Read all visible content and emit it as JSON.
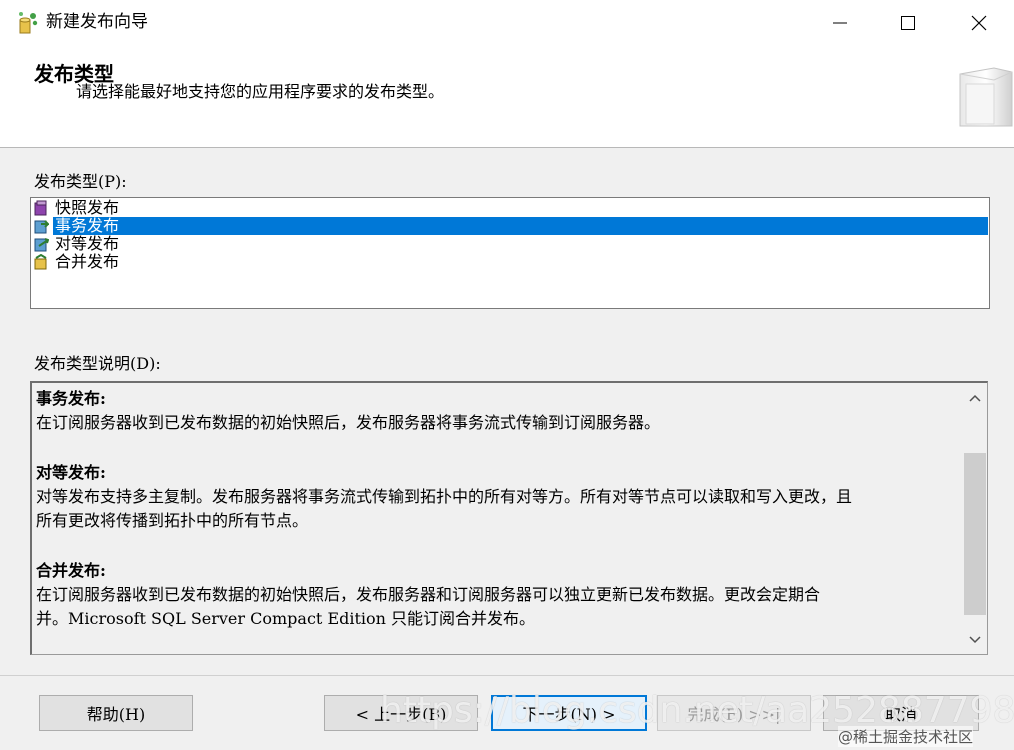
{
  "window": {
    "title": "新建发布向导",
    "icon": "publication-wizard-icon"
  },
  "header": {
    "title": "发布类型",
    "subtitle": "请选择能最好地支持您的应用程序要求的发布类型。"
  },
  "publication_type": {
    "label": "发布类型(P):",
    "items": [
      {
        "label": "快照发布",
        "icon": "snapshot-publication-icon",
        "selected": false
      },
      {
        "label": "事务发布",
        "icon": "transactional-publication-icon",
        "selected": true
      },
      {
        "label": "对等发布",
        "icon": "peer-to-peer-publication-icon",
        "selected": false
      },
      {
        "label": "合并发布",
        "icon": "merge-publication-icon",
        "selected": false
      }
    ]
  },
  "description": {
    "label": "发布类型说明(D):",
    "sections": [
      {
        "title": "事务发布:",
        "lines": [
          "在订阅服务器收到已发布数据的初始快照后，发布服务器将事务流式传输到订阅服务器。"
        ]
      },
      {
        "title": "对等发布:",
        "lines": [
          "对等发布支持多主复制。发布服务器将事务流式传输到拓扑中的所有对等方。所有对等节点可以读取和写入更改，且",
          "所有更改将传播到拓扑中的所有节点。"
        ]
      },
      {
        "title": "合并发布:",
        "lines": [
          "在订阅服务器收到已发布数据的初始快照后，发布服务器和订阅服务器可以独立更新已发布数据。更改会定期合",
          "并。Microsoft SQL Server Compact Edition 只能订阅合并发布。"
        ]
      }
    ]
  },
  "buttons": {
    "help": "帮助(H)",
    "back": "< 上一步(B)",
    "next": "下一步(N) >",
    "finish": "完成(F) >>|",
    "cancel": "取消"
  },
  "watermark": {
    "url": "https://blog.csdn.net/aa2528877987",
    "community": "@稀土掘金技术社区"
  }
}
